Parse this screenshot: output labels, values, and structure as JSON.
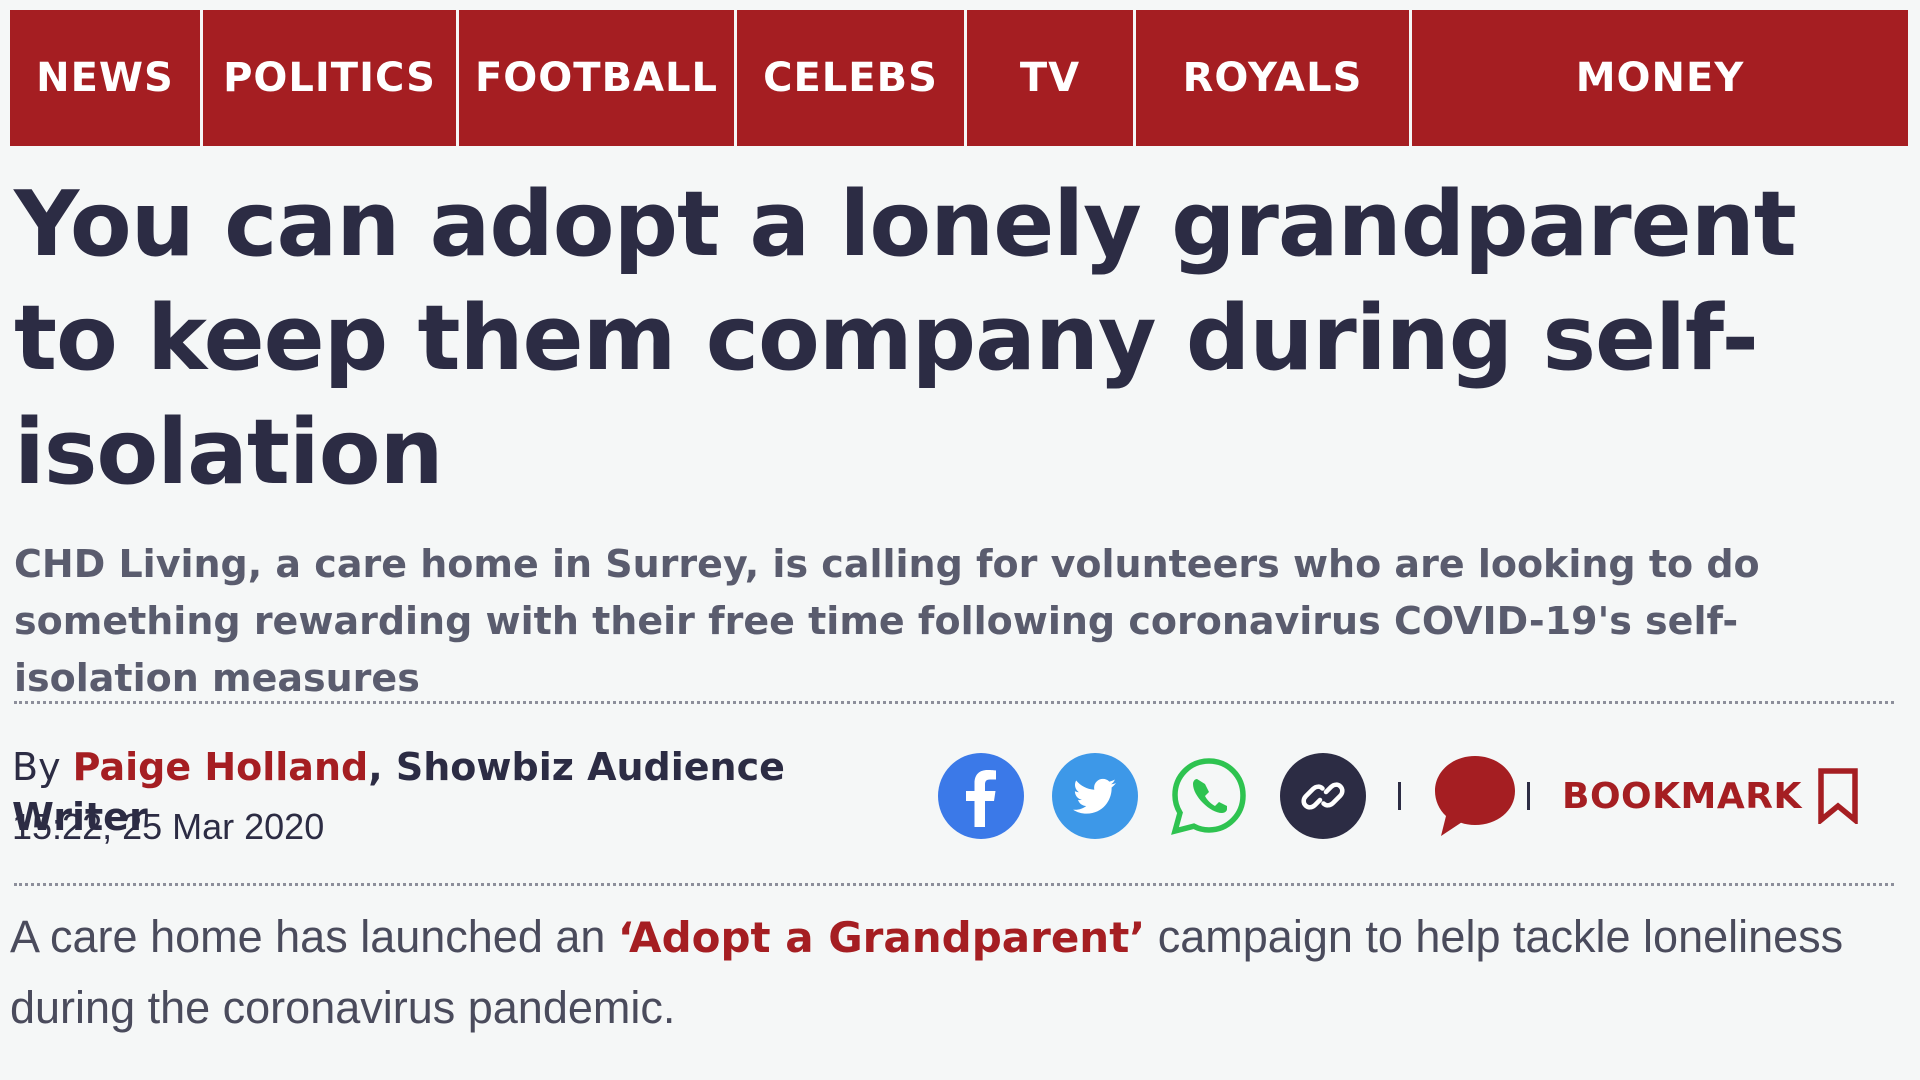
{
  "nav": {
    "items": [
      {
        "label": "NEWS"
      },
      {
        "label": "POLITICS"
      },
      {
        "label": "FOOTBALL"
      },
      {
        "label": "CELEBS"
      },
      {
        "label": "TV"
      },
      {
        "label": "ROYALS"
      },
      {
        "label": "MONEY"
      }
    ]
  },
  "article": {
    "headline": "You can adopt a lonely grandparent to keep them company during self-isolation",
    "standfirst": "CHD Living, a care home in Surrey, is calling for volunteers who are looking to do something rewarding with their free time following coronavirus COVID-19's self-isolation measures",
    "byline": {
      "prefix": "By ",
      "author": "Paige Holland",
      "role": ", Showbiz Audience Writer",
      "timestamp": "15:22, 25 Mar 2020"
    },
    "share": {
      "icons": [
        "facebook-icon",
        "twitter-icon",
        "whatsapp-icon",
        "link-icon",
        "comment-icon",
        "bookmark-icon"
      ],
      "bookmark_label": "BOOKMARK"
    },
    "body": {
      "before": "A care home has launched an ",
      "link": "‘Adopt a Grandparent’",
      "after": " campaign to help tackle loneliness during the coronavirus pandemic."
    }
  },
  "colors": {
    "brand_red": "#a51e22",
    "text_dark": "#2c2c44",
    "facebook": "#3b79e8",
    "twitter": "#3d98e8",
    "whatsapp": "#2ec350"
  }
}
